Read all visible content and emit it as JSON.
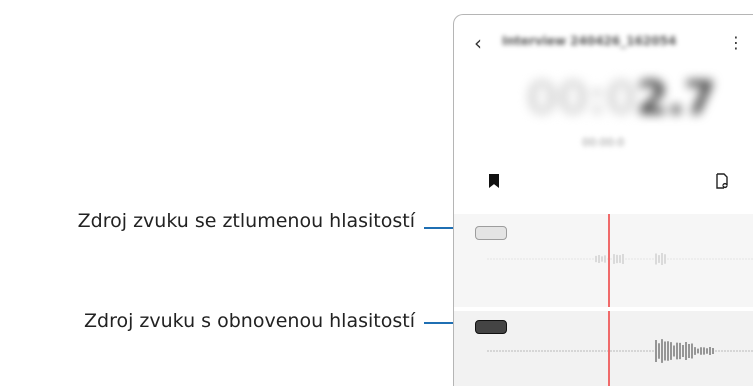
{
  "callouts": {
    "muted_label": "Zdroj zvuku se ztlumenou hlasitostí",
    "restored_label": "Zdroj zvuku s obnovenou hlasitostí",
    "leader_color": "#1f6fb3"
  },
  "recorder": {
    "title": "Interview 240426_162054",
    "timer_dim": "00:0",
    "timer_main": "2.7",
    "subtitle": "00:00:0",
    "back_glyph": "‹",
    "more_glyph": "⋮",
    "icons": [
      "back-arrow-icon",
      "more-options-icon",
      "bookmark-icon",
      "add-note-icon",
      "muted-source-chip",
      "restored-source-chip"
    ],
    "playhead_color": "#f06a6a"
  }
}
